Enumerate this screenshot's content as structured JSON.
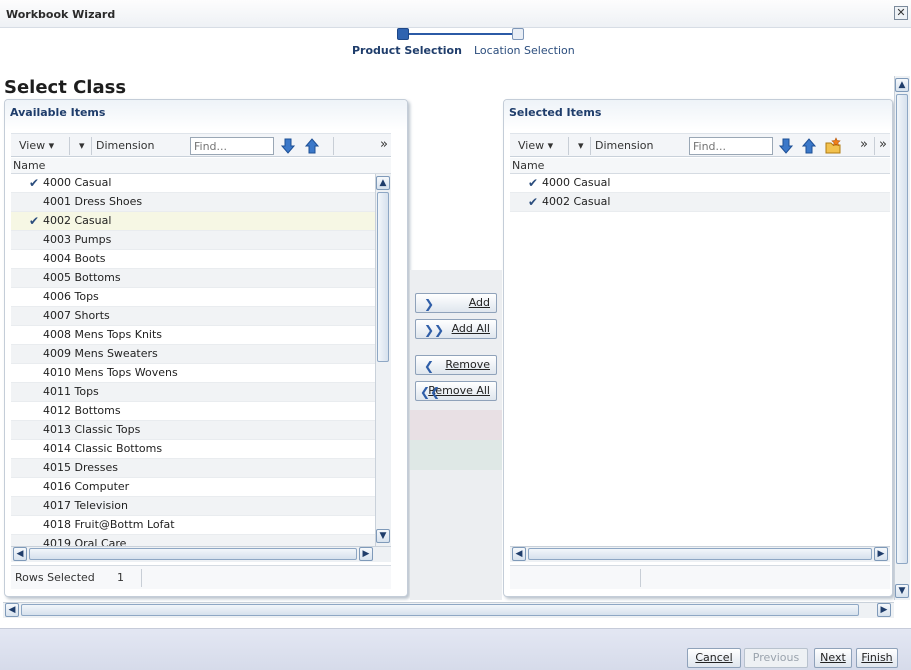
{
  "window": {
    "title": "Workbook Wizard"
  },
  "train": {
    "steps": [
      "Product Selection",
      "Location Selection"
    ]
  },
  "page": {
    "title": "Select Class"
  },
  "available": {
    "title": "Available Items",
    "toolbar": {
      "view": "View",
      "dimension": "Dimension",
      "find_placeholder": "Find...",
      "more": "»"
    },
    "column": "Name",
    "rows": [
      "4000 Casual",
      "4001 Dress Shoes",
      "4002 Casual",
      "4003 Pumps",
      "4004 Boots",
      "4005 Bottoms",
      "4006 Tops",
      "4007 Shorts",
      "4008 Mens Tops Knits",
      "4009 Mens Sweaters",
      "4010 Mens Tops Wovens",
      "4011 Tops",
      "4012 Bottoms",
      "4013 Classic Tops",
      "4014 Classic Bottoms",
      "4015 Dresses",
      "4016 Computer",
      "4017 Television",
      "4018 Fruit@Bottm Lofat",
      "4019 Oral Care"
    ],
    "checked_rows": [
      0,
      2
    ],
    "status": {
      "label": "Rows Selected",
      "value": "1"
    }
  },
  "shuttle": {
    "add": "Add",
    "add_all": "Add All",
    "remove": "Remove",
    "remove_all": "Remove All"
  },
  "selected": {
    "title": "Selected Items",
    "toolbar": {
      "view": "View",
      "dimension": "Dimension",
      "find_placeholder": "Find...",
      "more": "»"
    },
    "column": "Name",
    "rows": [
      "4000 Casual",
      "4002 Casual"
    ]
  },
  "footer": {
    "cancel": "Cancel",
    "previous": "Previous",
    "next": "Next",
    "finish": "Finish"
  },
  "colors": {
    "accent": "#2f63b0",
    "title_text": "#1f3d6b",
    "footer_bg": "#dde2ef"
  }
}
